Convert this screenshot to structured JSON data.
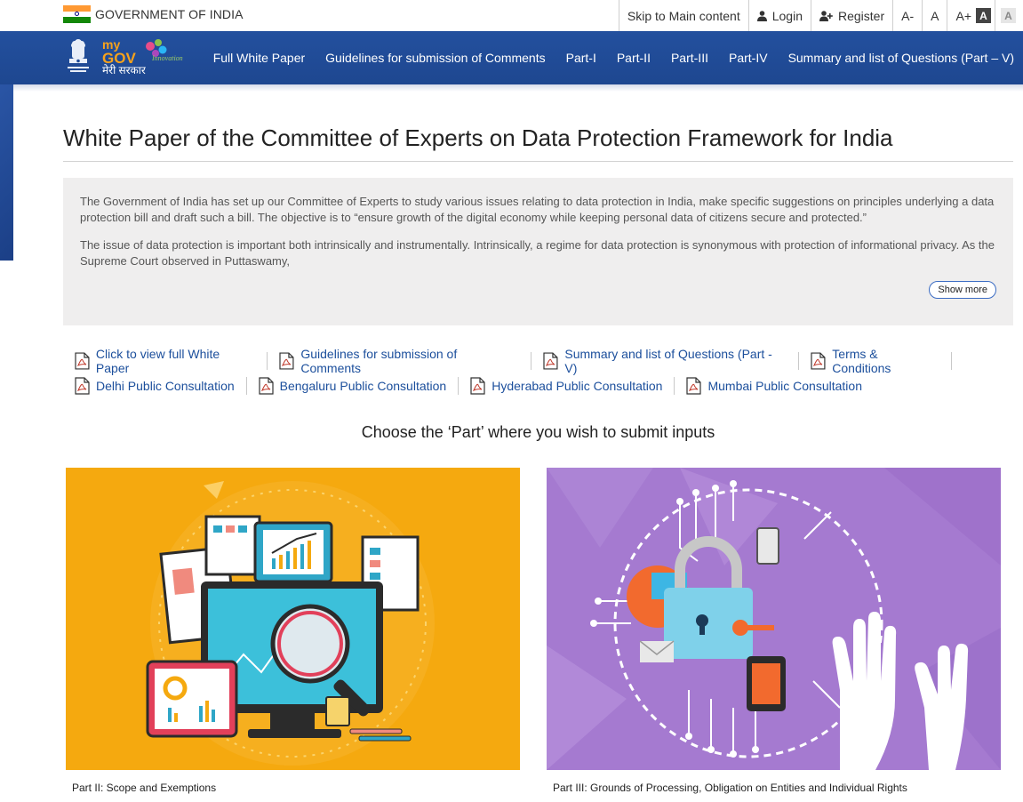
{
  "gov_bar": {
    "title": "GOVERNMENT OF INDIA",
    "skip": "Skip to Main content",
    "login": "Login",
    "register": "Register",
    "font_smaller": "A-",
    "font_normal": "A",
    "font_larger": "A+",
    "contrast_dark": "A",
    "contrast_light": "A"
  },
  "nav": {
    "logo_text": "मेरी सरकार",
    "items": [
      "Full White Paper",
      "Guidelines for submission of Comments",
      "Part-I",
      "Part-II",
      "Part-III",
      "Part-IV",
      "Summary and list of Questions (Part – V)"
    ]
  },
  "page": {
    "title": "White Paper of the Committee of Experts on Data Protection Framework for India",
    "intro_p1": "The Government of India has set up our Committee of Experts to study various issues relating to data protection in India, make specific suggestions on principles underlying a data protection bill and draft such a bill. The objective is to “ensure growth of the digital economy while keeping personal data of citizens secure and protected.”",
    "intro_p2": "The issue of data protection is important both intrinsically and instrumentally. Intrinsically, a regime for data protection is synonymous with protection of informational privacy. As the Supreme Court observed in Puttaswamy,",
    "show_more": "Show more"
  },
  "links": {
    "row1": [
      "Click to view full White Paper",
      "Guidelines for submission of Comments",
      "Summary and list of Questions (Part - V)",
      "Terms & Conditions"
    ],
    "row2": [
      "Delhi Public Consultation",
      "Bengaluru Public Consultation",
      "Hyderabad Public Consultation",
      "Mumbai Public Consultation"
    ]
  },
  "parts": {
    "heading": "Choose the ‘Part’ where you wish to submit inputs",
    "cards": [
      {
        "label": "Part II: Scope and Exemptions"
      },
      {
        "label": "Part III: Grounds of Processing, Obligation on Entities and Individual Rights"
      }
    ]
  },
  "colors": {
    "nav_bg": "#1f4a96",
    "link": "#1c4f9c",
    "card1_bg": "#f5a90f",
    "card2_bg": "#a57ad0"
  }
}
